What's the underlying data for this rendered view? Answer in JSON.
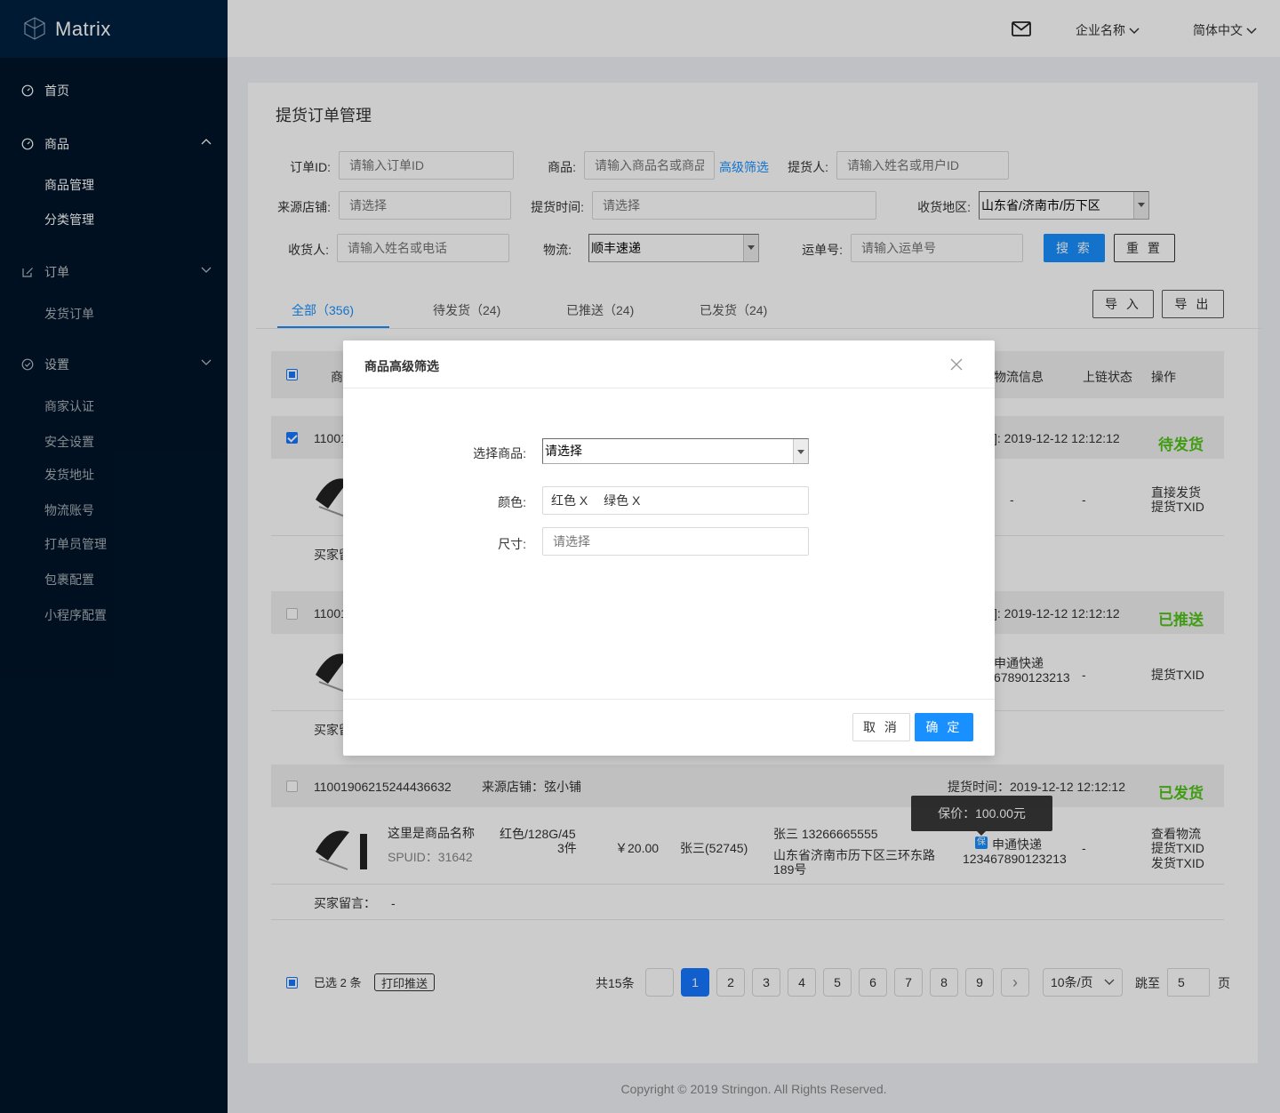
{
  "app": {
    "name": "Matrix"
  },
  "sidebar": {
    "home": "首页",
    "goods": {
      "label": "商品",
      "items": [
        "商品管理",
        "分类管理"
      ]
    },
    "orders": {
      "label": "订单",
      "items": [
        "发货订单"
      ]
    },
    "settings": {
      "label": "设置",
      "items": [
        "商家认证",
        "安全设置",
        "发货地址",
        "物流账号",
        "打单员管理",
        "包裹配置",
        "小程序配置"
      ]
    }
  },
  "header": {
    "company": "企业名称",
    "language": "简体中文"
  },
  "page": {
    "title": "提货订单管理"
  },
  "filters": {
    "order_id": {
      "label": "订单ID:",
      "placeholder": "请输入订单ID"
    },
    "goods": {
      "label": "商品:",
      "placeholder": "请输入商品名或商品",
      "advanced": "高级筛选"
    },
    "picker": {
      "label": "提货人:",
      "placeholder": "请输入姓名或用户ID"
    },
    "source_store": {
      "label": "来源店铺:",
      "placeholder": "请选择"
    },
    "pickup_time": {
      "label": "提货时间:",
      "placeholder": "请选择"
    },
    "region": {
      "label": "收货地区:",
      "value": "山东省/济南市/历下区"
    },
    "receiver": {
      "label": "收货人:",
      "placeholder": "请输入姓名或电话"
    },
    "logistics": {
      "label": "物流:",
      "value": "顺丰速递"
    },
    "tracking": {
      "label": "运单号:",
      "placeholder": "请输入运单号"
    },
    "search_btn": "搜 索",
    "reset_btn": "重 置"
  },
  "tabs": [
    {
      "label": "全部（356)"
    },
    {
      "label": "待发货（24)"
    },
    {
      "label": "已推送（24)"
    },
    {
      "label": "已发货（24)"
    }
  ],
  "actions": {
    "import": "导 入",
    "export": "导 出"
  },
  "table": {
    "headers": {
      "goods": "商",
      "logistics": "物流信息",
      "chain": "上链状态",
      "ops": "操作"
    }
  },
  "orders": [
    {
      "id": "11001",
      "time_label": "]: 2019-12-12  12:12:12",
      "status": "待发货",
      "logistics": "-",
      "chain": "-",
      "ops": [
        "直接发货",
        "提货TXID"
      ],
      "note_label": "买家留"
    },
    {
      "id": "11001",
      "time_label": "]: 2019-12-12  12:12:12",
      "status": "已推送",
      "logistics_name": "申通快递",
      "logistics_no": "67890123213",
      "chain": "-",
      "ops": [
        "提货TXID"
      ],
      "note_label": "买家留"
    },
    {
      "id": "11001906215244436632",
      "store": "来源店铺：弦小铺",
      "time_label": "提货时间：2019-12-12  12:12:12",
      "status": "已发货",
      "goods_name": "这里是商品名称",
      "spuid": "SPUID：31642",
      "spec": "红色/128G/45",
      "qty": "3件",
      "price": "￥20.00",
      "buyer": "张三(52745)",
      "receiver": "张三   13266665555",
      "address1": "山东省济南市历下区三环东路",
      "address2": "189号",
      "logistics_name": "申通快递",
      "logistics_no": "123467890123213",
      "chain": "-",
      "ops": [
        "查看物流",
        "提货TXID",
        "发货TXID"
      ],
      "note_label": "买家留言：",
      "note": "-",
      "tooltip": "保价：100.00元",
      "badge": "保"
    }
  ],
  "bulk": {
    "selected": "已选 2 条",
    "print": "打印推送"
  },
  "pagination": {
    "total": "共15条",
    "pages": [
      "1",
      "2",
      "3",
      "4",
      "5",
      "6",
      "7",
      "8",
      "9"
    ],
    "next": "›",
    "page_size": "10条/页",
    "jump_label": "跳至",
    "jump_value": "5",
    "jump_suffix": "页"
  },
  "footer": "Copyright © 2019 Stringon. All Rights Reserved.",
  "modal": {
    "title": "商品高级筛选",
    "select_goods": {
      "label": "选择商品:",
      "value": "请选择"
    },
    "color": {
      "label": "颜色:",
      "tags": [
        "红色 X",
        "绿色  X"
      ]
    },
    "size": {
      "label": "尺寸:",
      "placeholder": "请选择"
    },
    "cancel": "取 消",
    "ok": "确 定"
  },
  "colors": {
    "sidebar": "#001529",
    "logo_bar": "#002140",
    "primary": "#1890ff",
    "success": "#52c41a"
  }
}
